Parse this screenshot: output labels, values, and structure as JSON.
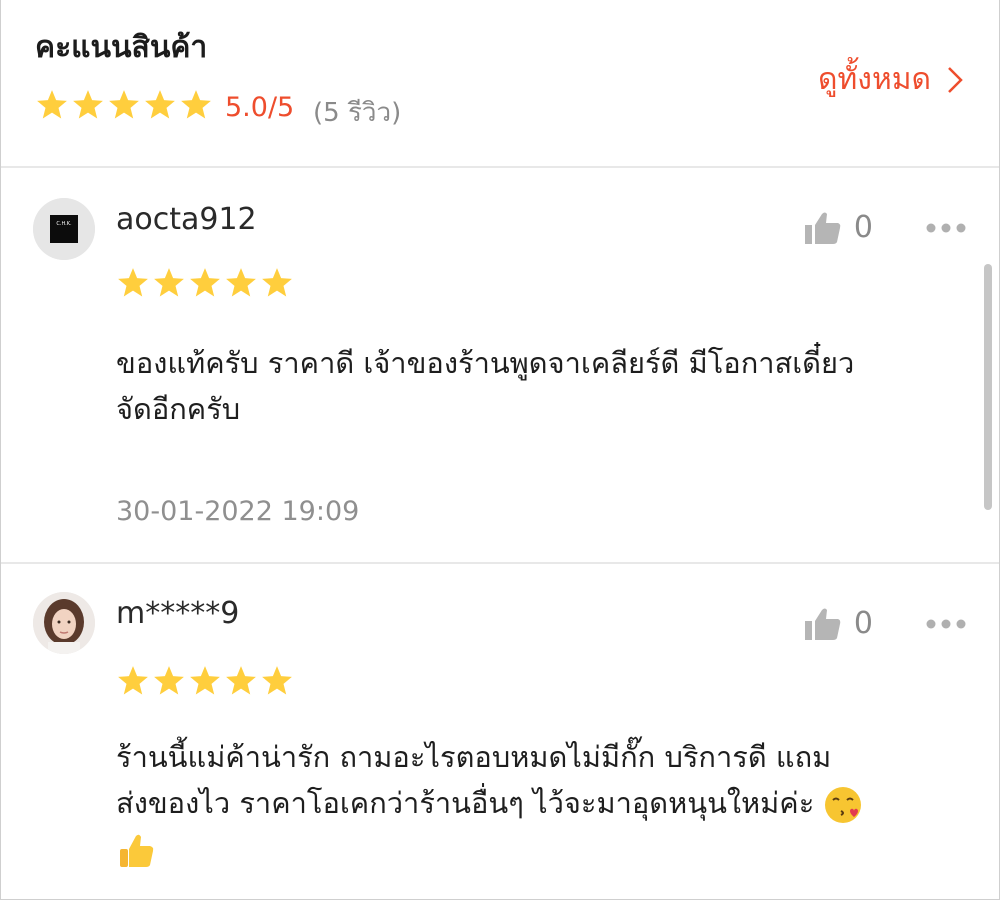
{
  "header": {
    "title": "คะแนนสินค้า",
    "rating": "5.0/5",
    "review_count": "(5 รีวิว)",
    "see_all": "ดูทั้งหมด",
    "star_count": 5
  },
  "reviews": [
    {
      "username": "aocta912",
      "stars": 5,
      "likes": "0",
      "text_line1": "ของแท้ครับ ราคาดี เจ้าของร้านพูดจาเคลียร์ดี มีโอกาสเดี๋ยว",
      "text_line2": "จัดอีกครับ",
      "date": "30-01-2022 19:09",
      "avatar_text": "C.H.K."
    },
    {
      "username": "m*****9",
      "stars": 5,
      "likes": "0",
      "text_line1": "ร้านนี้แม่ค้าน่ารัก ถามอะไรตอบหมดไม่มีกั๊ก บริการดี แถม",
      "text_line2": "ส่งของไว ราคาโอเคกว่าร้านอื่นๆ ไว้จะมาอุดหนุนใหม่ค่ะ"
    }
  ],
  "icons": {
    "star": "star-icon",
    "like": "thumbs-up-icon",
    "more": "more-dots-icon",
    "chevron": "chevron-right-icon",
    "kiss_emoji": "kissing-wink-emoji",
    "thumbs_emoji": "thumbs-up-emoji"
  },
  "colors": {
    "accent": "#ee4d2d",
    "star": "#ffce3d",
    "muted": "#8a8a8a"
  }
}
